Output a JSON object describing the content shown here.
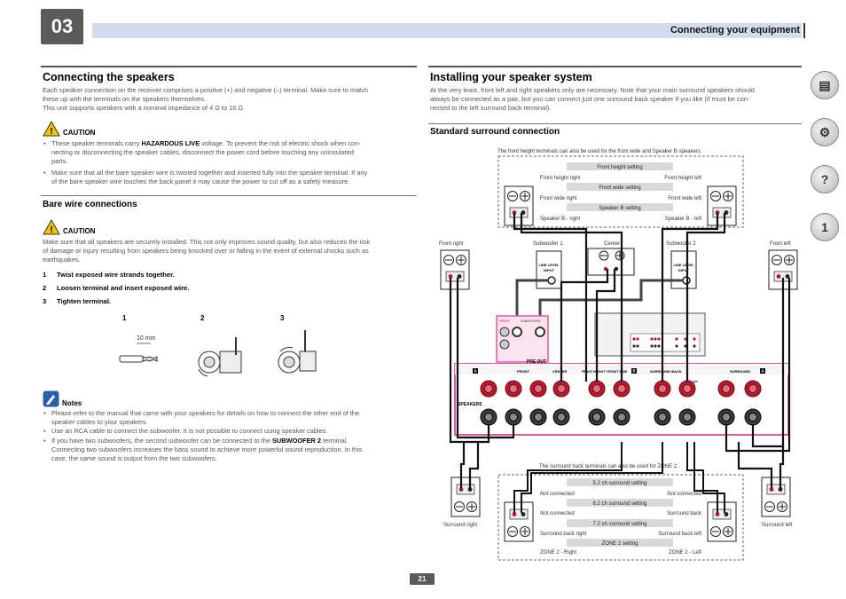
{
  "header": {
    "chapter": "03",
    "title": "Connecting your equipment"
  },
  "left": {
    "title": "Connecting the speakers",
    "intro": [
      "Each speaker connection on the receiver comprises a positive (+) and negative (–) terminal. Make sure to match",
      "these up with the terminals on the speakers themselves.",
      "This unit supports speakers with a nominal impedance of 4 Ω to 16 Ω."
    ],
    "caution1": {
      "label": "CAUTION",
      "bullet1_pre": "These speaker terminals carry ",
      "bullet1_bold": "HAZARDOUS LIVE",
      "bullet1_post": " voltage. To prevent the risk of electric shock when con-",
      "bullet1_line2": "necting or disconnecting the speaker cables, disconnect the power cord before touching any uninsulated",
      "bullet1_line3": "parts.",
      "bullet2": [
        "Make sure that all the bare speaker wire is twisted together and inserted fully into the speaker terminal. If any",
        "of the bare speaker wire touches the back panel it may cause the power to cut off as a safety measure."
      ]
    },
    "bare_wire": {
      "title": "Bare wire connections",
      "caution_label": "CAUTION",
      "text": [
        "Make sure that all speakers are securely installed. This not only improves sound quality, but also reduces the risk",
        "of damage or injury resulting from speakers being knocked over or falling in the event of external shocks such as",
        "earthquakes."
      ],
      "steps": [
        {
          "num": "1",
          "text": "Twist exposed wire strands together."
        },
        {
          "num": "2",
          "text": "Loosen terminal and insert exposed wire."
        },
        {
          "num": "3",
          "text": "Tighten terminal."
        }
      ],
      "figure_labels": [
        "1",
        "2",
        "3"
      ],
      "measure": "10 mm"
    },
    "notes": {
      "label": "Notes",
      "items": [
        [
          "Please refer to the manual that came with your speakers for details on how to connect the other end of the",
          "speaker cables to your speakers."
        ],
        [
          "Use an RCA cable to connect the subwoofer. It is not possible to connect using speaker cables."
        ]
      ],
      "item3_pre": "If you have two subwoofers, the second subwoofer can be connected to the ",
      "item3_bold": "SUBWOOFER 2",
      "item3_post": " terminal.",
      "item3_rest": [
        "Connecting two subwoofers increases the bass sound to achieve more powerful sound reproduction. In this",
        "case, the same sound is output from the two subwoofers."
      ]
    }
  },
  "right": {
    "title": "Installing your speaker system",
    "intro": [
      "At the very least, front left and right speakers only are necessary. Note that your main surround speakers should",
      "always be connected as a pair, but you can connect just one surround back speaker if you like (if must be con-",
      "nected to the left surround back terminal)."
    ],
    "subtitle": "Standard surround connection",
    "diagram": {
      "top_note": "The front height terminals can also be used for the front wide and Speaker B speakers.",
      "top_box": {
        "s1": "Front height setting",
        "s1_left": "Front height right",
        "s1_right": "Front height left",
        "s2": "Front wide setting",
        "s2_left": "Front wide right",
        "s2_right": "Front wide left",
        "s3": "Speaker B setting",
        "s3_left": "Speaker B - right",
        "s3_right": "Speaker B - left"
      },
      "speakers": {
        "front_right": "Front right",
        "sub1": "Subwoofer 1",
        "center": "Center",
        "sub2": "Subwoofer 2",
        "front_left": "Front left",
        "surround_right": "Surround right",
        "surround_left": "Surround left"
      },
      "line_level": "LINE LEVEL",
      "input": "INPUT",
      "pre_out": "PRE OUT",
      "subwoofer": "SUBWOOFER",
      "front_small": "FRONT",
      "panel": {
        "a1": "A",
        "a2": "A",
        "b": "B",
        "front": "FRONT",
        "center": "CENTER",
        "fh": "FRONT HEIGHT / FRONT WIDE",
        "sb": "SURROUND BACK",
        "surround": "SURROUND",
        "speakers": "SPEAKERS",
        "r": "R",
        "l": "L",
        "single": "Single"
      },
      "bottom_note": "The surround back terminals can also be used for ZONE 2.",
      "bottom_box": {
        "s1": "5.2 ch surround setting",
        "s1_left": "Not connected",
        "s1_right": "Not connected",
        "s2": "6.2 ch surround setting",
        "s2_left": "Not connected",
        "s2_right": "Surround back",
        "s3": "7.2 ch surround setting",
        "s3_left": "Surround back right",
        "s3_right": "Surround back left",
        "s4": "ZONE 2 setting",
        "s4_left": "ZONE 2 - Right",
        "s4_right": "ZONE 2 - Left"
      }
    }
  },
  "page_number": "21",
  "colors": {
    "header_bar": "#d3dcee",
    "chapter_box": "#5a5a5a",
    "setting_band": "#d9d9d9",
    "panel_highlight": "#e05aa0",
    "terminal_red": "#b8192b"
  }
}
